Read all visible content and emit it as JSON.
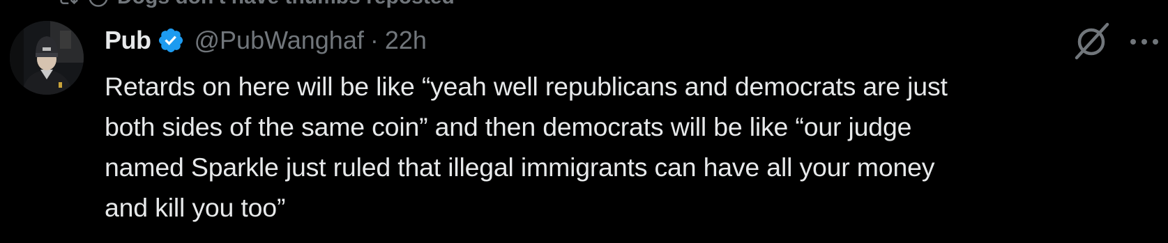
{
  "repost": {
    "icon": "repost-icon",
    "text": "Dogs don't have thumbs reposted"
  },
  "post": {
    "author_name": "Pub",
    "verified_icon": "verified-badge-icon",
    "handle": "@PubWanghaf",
    "separator": "·",
    "time": "22h",
    "avatar_icon": "avatar",
    "grok_icon": "grok-icon",
    "more_icon": "more-options-icon",
    "text_lines": [
      "Retards on here will be like “yeah well republicans and democrats are just",
      "both sides of the same coin” and then democrats will be like “our judge",
      "named Sparkle just ruled that illegal immigrants can have all your money",
      "and kill you too”"
    ]
  },
  "colors": {
    "background": "#000000",
    "primary_text": "#e7e9ea",
    "secondary_text": "#71767b",
    "verified_blue": "#1d9bf0"
  }
}
